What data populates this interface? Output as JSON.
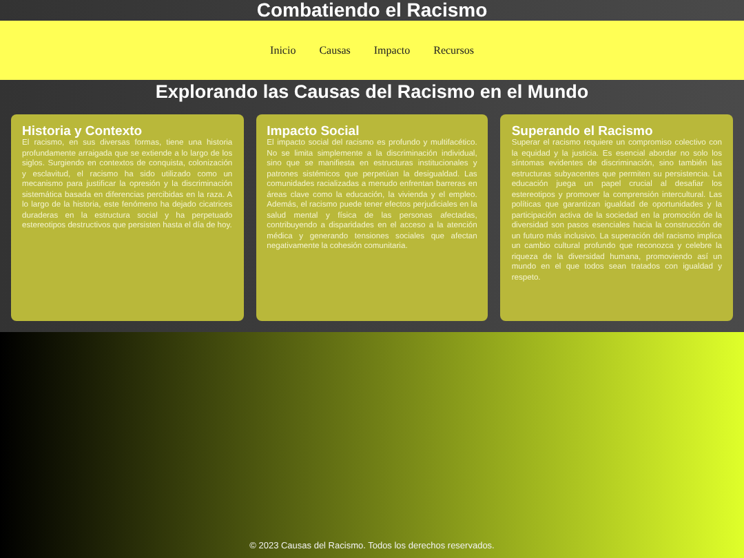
{
  "header": {
    "title": "Combatiendo el Racismo"
  },
  "nav": {
    "links": [
      "Inicio",
      "Causas",
      "Impacto",
      "Recursos"
    ]
  },
  "main": {
    "heading": "Explorando las Causas del Racismo en el Mundo",
    "cards": [
      {
        "title": "Historia y Contexto",
        "text": "El racismo, en sus diversas formas, tiene una historia profundamente arraigada que se extiende a lo largo de los siglos. Surgiendo en contextos de conquista, colonización y esclavitud, el racismo ha sido utilizado como un mecanismo para justificar la opresión y la discriminación sistemática basada en diferencias percibidas en la raza. A lo largo de la historia, este fenómeno ha dejado cicatrices duraderas en la estructura social y ha perpetuado estereotipos destructivos que persisten hasta el día de hoy."
      },
      {
        "title": "Impacto Social",
        "text": "El impacto social del racismo es profundo y multifacético. No se limita simplemente a la discriminación individual, sino que se manifiesta en estructuras institucionales y patrones sistémicos que perpetúan la desigualdad. Las comunidades racializadas a menudo enfrentan barreras en áreas clave como la educación, la vivienda y el empleo. Además, el racismo puede tener efectos perjudiciales en la salud mental y física de las personas afectadas, contribuyendo a disparidades en el acceso a la atención médica y generando tensiones sociales que afectan negativamente la cohesión comunitaria."
      },
      {
        "title": "Superando el Racismo",
        "text": "Superar el racismo requiere un compromiso colectivo con la equidad y la justicia. Es esencial abordar no solo los síntomas evidentes de discriminación, sino también las estructuras subyacentes que permiten su persistencia. La educación juega un papel crucial al desafiar los estereotipos y promover la comprensión intercultural. Las políticas que garantizan igualdad de oportunidades y la participación activa de la sociedad en la promoción de la diversidad son pasos esenciales hacia la construcción de un futuro más inclusivo. La superación del racismo implica un cambio cultural profundo que reconozca y celebre la riqueza de la diversidad humana, promoviendo así un mundo en el que todos sean tratados con igualdad y respeto."
      }
    ]
  },
  "footer": {
    "text": "© 2023 Causas del Racismo. Todos los derechos reservados."
  }
}
